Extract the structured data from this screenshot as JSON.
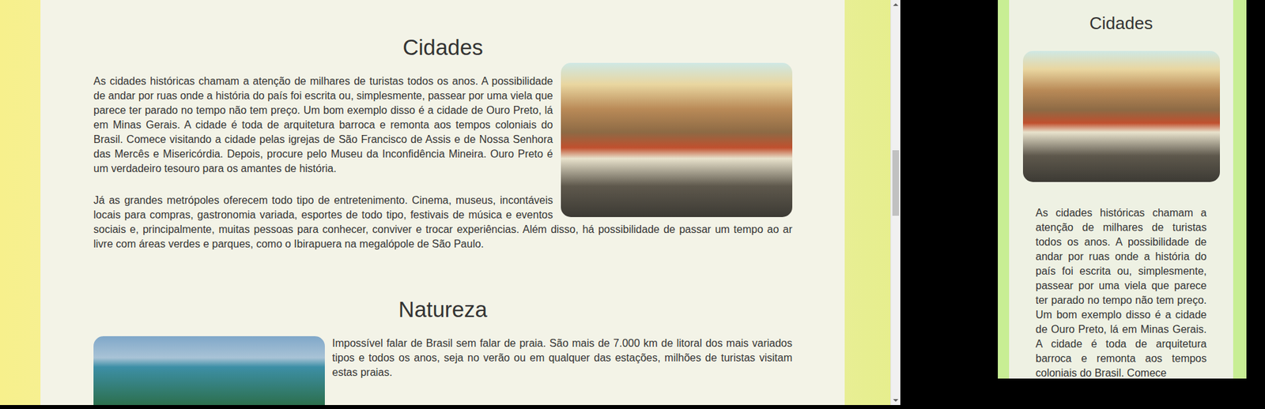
{
  "desktop": {
    "sections": [
      {
        "title": "Cidades",
        "kind": "image-right",
        "paragraphs": [
          "As cidades históricas chamam a atenção de milhares de turistas todos os anos. A possibilidade de andar por ruas onde a história do país foi escrita ou, simplesmente, passear por uma viela que parece ter parado no tempo não tem preço. Um bom exemplo disso é a cidade de Ouro Preto, lá em Minas Gerais. A cidade é toda de arquitetura barroca e remonta aos tempos coloniais do Brasil. Comece visitando a cidade pelas igrejas de São Francisco de Assis e de Nossa Senhora das Mercês e Misericórdia. Depois, procure pelo Museu da Inconfidência Mineira. Ouro Preto é um verdadeiro tesouro para os amantes de história.",
          "Já as grandes metrópoles oferecem todo tipo de entretenimento. Cinema, museus, incontáveis locais para compras, gastronomia variada, esportes de todo tipo, festivais de música e eventos sociais e, principalmente, muitas pessoas para conhecer, conviver e trocar experiências. Além disso, há possibilidade de passar um tempo ao ar livre com áreas verdes e parques, como o Ibirapuera na megalópole de São Paulo."
        ]
      },
      {
        "title": "Natureza",
        "kind": "image-left",
        "paragraphs": [
          "Impossível falar de Brasil sem falar de praia. São mais de 7.000 km de litoral dos mais variados tipos e todos os anos, seja no verão ou em qualquer das estações, milhões de turistas visitam estas praias."
        ]
      }
    ],
    "scrollbar": {
      "level": 0.44
    }
  },
  "mobile": {
    "sections": [
      {
        "title": "Cidades",
        "paragraphs": [
          "As cidades históricas chamam a atenção de milhares de turistas todos os anos. A possibilidade de andar por ruas onde a história do país foi escrita ou, simplesmente, passear por uma viela que parece ter parado no tempo não tem preço. Um bom exemplo disso é a cidade de Ouro Preto, lá em Minas Gerais. A cidade é toda de arquitetura barroca e remonta aos tempos coloniais do Brasil. Comece"
        ]
      }
    ]
  }
}
